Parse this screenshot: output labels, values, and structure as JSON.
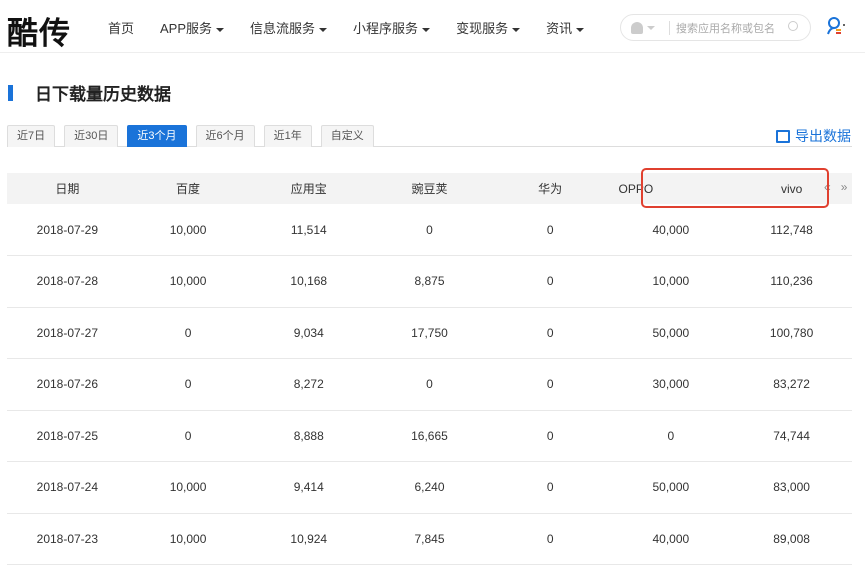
{
  "logo": "酷传",
  "nav": [
    {
      "label": "首页",
      "dropdown": false
    },
    {
      "label": "APP服务",
      "dropdown": true
    },
    {
      "label": "信息流服务",
      "dropdown": true
    },
    {
      "label": "小程序服务",
      "dropdown": true
    },
    {
      "label": "变现服务",
      "dropdown": true
    },
    {
      "label": "资讯",
      "dropdown": true
    }
  ],
  "search": {
    "placeholder": "搜索应用名称或包名"
  },
  "page_title": "日下载量历史数据",
  "tabs": [
    "近7日",
    "近30日",
    "近3个月",
    "近6个月",
    "近1年",
    "自定义"
  ],
  "active_tab": "近3个月",
  "export_label": "导出数据",
  "pager": {
    "prev": "«",
    "next": "»"
  },
  "table": {
    "headers": [
      "日期",
      "百度",
      "应用宝",
      "豌豆荚",
      "华为",
      "OPPO",
      "vivo"
    ],
    "rows": [
      [
        "2018-07-29",
        "10,000",
        "11,514",
        "0",
        "0",
        "40,000",
        "112,748"
      ],
      [
        "2018-07-28",
        "10,000",
        "10,168",
        "8,875",
        "0",
        "10,000",
        "110,236"
      ],
      [
        "2018-07-27",
        "0",
        "9,034",
        "17,750",
        "0",
        "50,000",
        "100,780"
      ],
      [
        "2018-07-26",
        "0",
        "8,272",
        "0",
        "0",
        "30,000",
        "83,272"
      ],
      [
        "2018-07-25",
        "0",
        "8,888",
        "16,665",
        "0",
        "0",
        "74,744"
      ],
      [
        "2018-07-24",
        "10,000",
        "9,414",
        "6,240",
        "0",
        "50,000",
        "83,000"
      ],
      [
        "2018-07-23",
        "10,000",
        "10,924",
        "7,845",
        "0",
        "40,000",
        "89,008"
      ]
    ]
  },
  "colors": {
    "accent": "#1a73d9",
    "highlight": "#e0402f"
  }
}
